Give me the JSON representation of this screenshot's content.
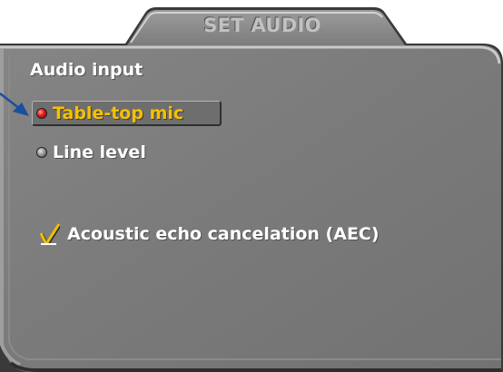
{
  "window": {
    "title": "SET AUDIO"
  },
  "audio_input": {
    "label": "Audio input",
    "options": [
      {
        "label": "Table-top mic",
        "selected": true
      },
      {
        "label": "Line level",
        "selected": false
      }
    ]
  },
  "aec": {
    "label": "Acoustic echo cancelation (AEC)",
    "checked": true
  },
  "colors": {
    "panel": "#7b7b7b",
    "selected_text": "#f5c100",
    "radio_selected": "#e01818",
    "pointer_arrow": "#1a4f9e",
    "check_mark": "#f0c000"
  },
  "icons": {
    "pointer": "arrow-pointer-icon",
    "radio_selected": "radio-selected-icon",
    "radio_unselected": "radio-unselected-icon",
    "checkbox": "checkmark-icon"
  }
}
